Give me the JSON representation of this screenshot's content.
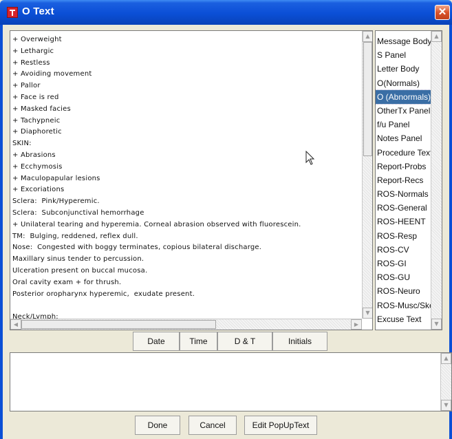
{
  "window": {
    "title": "O Text",
    "close_glyph": "✕"
  },
  "text_lines": [
    "+ Overweight",
    "+ Lethargic",
    "+ Restless",
    "+ Avoiding movement",
    "+ Pallor",
    "+ Face is red",
    "+ Masked facies",
    "+ Tachypneic",
    "+ Diaphoretic",
    "SKIN:",
    "+ Abrasions",
    "+ Ecchymosis",
    "+ Maculopapular lesions",
    "+ Excoriations",
    "Sclera:  Pink/Hyperemic.",
    "Sclera:  Subconjunctival hemorrhage",
    "+ Unilateral tearing and hyperemia. Corneal abrasion observed with fluorescein.",
    "TM:  Bulging, reddened, reflex dull.",
    "Nose:  Congested with boggy terminates, copious bilateral discharge.",
    "Maxillary sinus tender to percussion.",
    "Ulceration present on buccal mucosa.",
    "Oral cavity exam + for thrush.",
    "Posterior oropharynx hyperemic,  exudate present.",
    "",
    "Neck/Lymph:"
  ],
  "list": {
    "items": [
      "Message Body",
      "S Panel",
      "Letter Body",
      "O(Normals)",
      "O (Abnormals)",
      "OtherTx Panel",
      "f/u Panel",
      "Notes Panel",
      "Procedure Text",
      "Report-Probs",
      "Report-Recs",
      "ROS-Normals",
      "ROS-General",
      "ROS-HEENT",
      "ROS-Resp",
      "ROS-CV",
      "ROS-GI",
      "ROS-GU",
      "ROS-Neuro",
      "ROS-Musc/Skel",
      "Excuse Text"
    ],
    "selected": "O (Abnormals)"
  },
  "insert_buttons": {
    "date": "Date",
    "time": "Time",
    "date_time": "D & T",
    "initials": "Initials"
  },
  "bottom_buttons": {
    "done": "Done",
    "cancel": "Cancel",
    "edit": "Edit PopUpText"
  },
  "colors": {
    "title_bar": "#0b4fd6",
    "selection": "#3a6ea5",
    "close": "#d9532c"
  }
}
